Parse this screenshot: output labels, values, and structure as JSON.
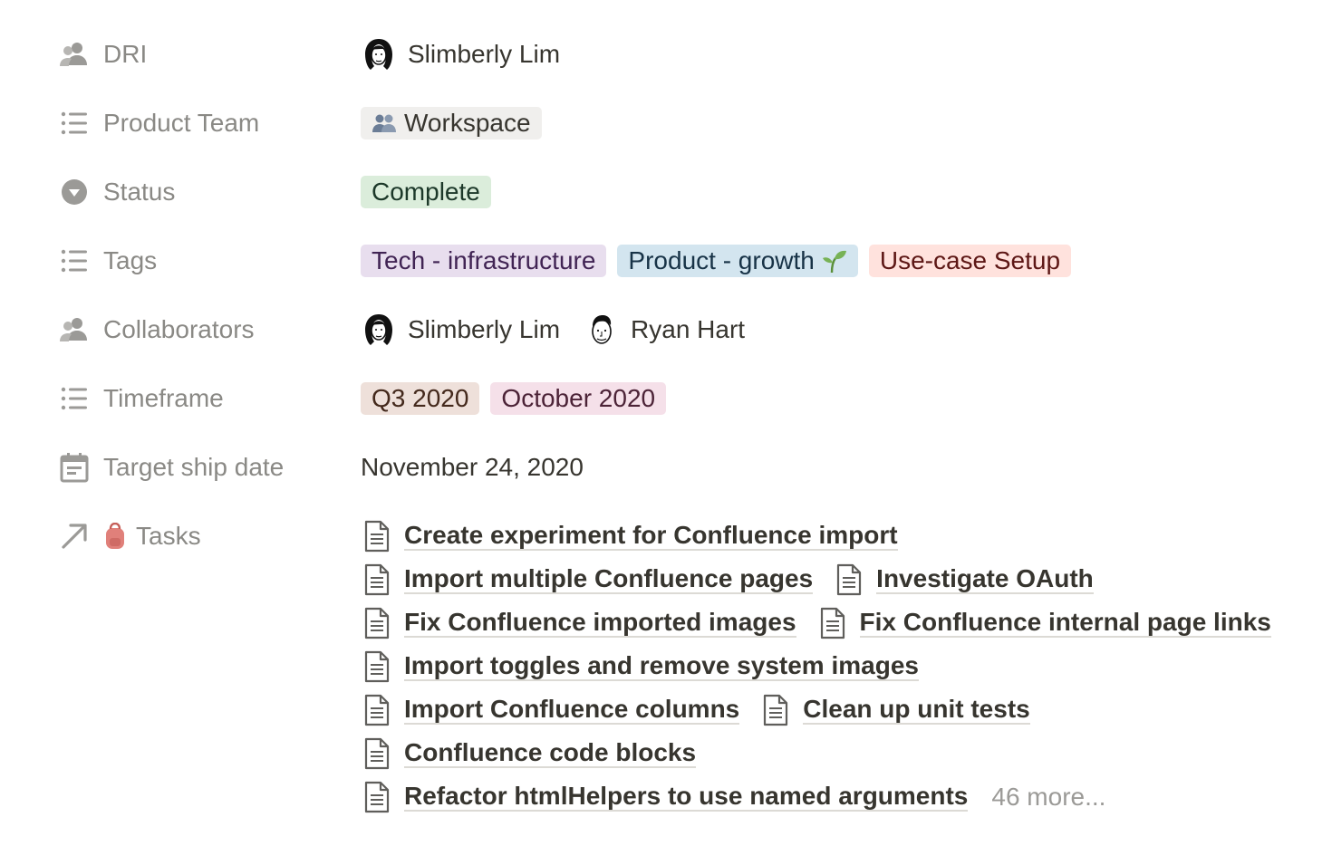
{
  "properties": [
    {
      "key": "dri",
      "label": "DRI",
      "icon": "people-icon"
    },
    {
      "key": "product_team",
      "label": "Product Team",
      "icon": "list-icon"
    },
    {
      "key": "status",
      "label": "Status",
      "icon": "select-icon"
    },
    {
      "key": "tags",
      "label": "Tags",
      "icon": "list-icon"
    },
    {
      "key": "collaborators",
      "label": "Collaborators",
      "icon": "people-icon"
    },
    {
      "key": "timeframe",
      "label": "Timeframe",
      "icon": "list-icon"
    },
    {
      "key": "target_ship_date",
      "label": "Target ship date",
      "icon": "calendar-icon"
    },
    {
      "key": "tasks",
      "label": "Tasks",
      "icon": "arrow-up-right-icon",
      "emoji_icon": "backpack-icon"
    }
  ],
  "dri": {
    "name": "Slimberly Lim"
  },
  "product_team": {
    "icon": "people-emoji-icon",
    "label": "Workspace",
    "color": "#f0efed"
  },
  "status": {
    "label": "Complete",
    "color": "#dbeddb"
  },
  "tags": [
    {
      "label": "Tech - infrastructure",
      "color": "#e8deee"
    },
    {
      "label": "Product - growth",
      "emoji": "seedling-icon",
      "color": "#d3e5ef"
    },
    {
      "label": "Use-case Setup",
      "color": "#ffe2dd"
    }
  ],
  "collaborators": [
    {
      "name": "Slimberly Lim",
      "avatar": "woman-avatar"
    },
    {
      "name": "Ryan Hart",
      "avatar": "man-avatar"
    }
  ],
  "timeframe": [
    {
      "label": "Q3 2020",
      "color": "#eee0da"
    },
    {
      "label": "October 2020",
      "color": "#f5e0e9"
    }
  ],
  "target_ship_date": "November 24, 2020",
  "tasks": {
    "lines": [
      [
        "Create experiment for Confluence import"
      ],
      [
        "Import multiple Confluence pages",
        "Investigate OAuth"
      ],
      [
        "Fix Confluence imported images",
        "Fix Confluence internal page links"
      ],
      [
        "Import toggles and remove system images"
      ],
      [
        "Import Confluence columns",
        "Clean up unit tests"
      ],
      [
        "Confluence code blocks"
      ],
      [
        "Refactor htmlHelpers to use named arguments"
      ]
    ],
    "more_label": "46 more..."
  },
  "colors": {
    "text": "#37352f",
    "muted": "#8a8985",
    "underline": "#dcdad5"
  }
}
